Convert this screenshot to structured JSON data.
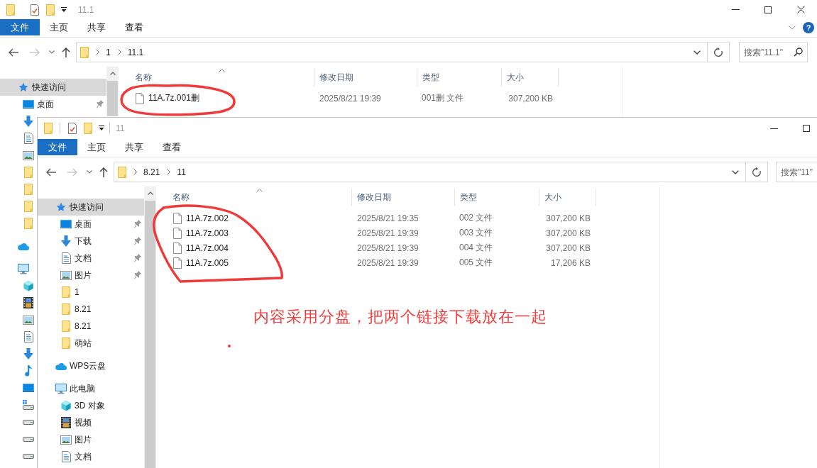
{
  "windows": [
    {
      "title": "11.1",
      "file_menu": "文件",
      "ribbon_tabs": [
        "主页",
        "共享",
        "查看"
      ],
      "help": "?",
      "nav": {
        "back_disabled": false,
        "forward_disabled": true
      },
      "address_path": [
        "1",
        "11.1"
      ],
      "search": {
        "placeholder": "搜索\"11.1\""
      },
      "sidebar": [
        {
          "kind": "quick_access",
          "label": "快速访问",
          "selected": true,
          "children": [
            {
              "kind": "desktop",
              "label": "桌面",
              "selected": false,
              "pinned": true
            },
            {
              "kind": "downloads",
              "selected": false
            },
            {
              "kind": "documents",
              "selected": false
            },
            {
              "kind": "pictures",
              "selected": false
            },
            {
              "kind": "folder",
              "selected": false
            },
            {
              "kind": "folder",
              "selected": false
            },
            {
              "kind": "folder",
              "selected": false
            },
            {
              "kind": "folder",
              "selected": false
            }
          ]
        },
        {
          "kind": "cloud",
          "selected": false
        },
        {
          "kind": "computer",
          "selected": false,
          "children": [
            {
              "kind": "objects3d",
              "selected": false
            },
            {
              "kind": "videos",
              "selected": false
            },
            {
              "kind": "pictures",
              "selected": false
            },
            {
              "kind": "documents",
              "selected": false
            },
            {
              "kind": "downloads",
              "selected": false
            },
            {
              "kind": "music",
              "selected": false
            },
            {
              "kind": "desktop",
              "selected": false
            },
            {
              "kind": "system_drive",
              "selected": false
            },
            {
              "kind": "drive",
              "selected": false
            },
            {
              "kind": "drive",
              "selected": false
            },
            {
              "kind": "drive",
              "selected": false
            }
          ]
        }
      ],
      "columns": [
        {
          "label": "名称",
          "sorted": true
        },
        {
          "label": "修改日期",
          "sorted": false
        },
        {
          "label": "类型",
          "sorted": false
        },
        {
          "label": "大小",
          "sorted": false
        }
      ],
      "files": [
        {
          "name": "11A.7z.001删",
          "modified": "2025/8/21 19:39",
          "type": "001删 文件",
          "size": "307,200 KB"
        }
      ]
    },
    {
      "title": "11",
      "file_menu": "文件",
      "ribbon_tabs": [
        "主页",
        "共享",
        "查看"
      ],
      "nav": {
        "back_disabled": false,
        "forward_disabled": true
      },
      "address_path": [
        "8.21",
        "11"
      ],
      "search": {
        "placeholder": "搜索\"11\""
      },
      "sidebar": [
        {
          "kind": "quick_access",
          "label": "快速访问",
          "selected": true,
          "children": [
            {
              "kind": "desktop",
              "label": "桌面",
              "selected": false,
              "pinned": true
            },
            {
              "kind": "downloads",
              "label": "下载",
              "selected": false,
              "pinned": true
            },
            {
              "kind": "documents",
              "label": "文档",
              "selected": false,
              "pinned": true
            },
            {
              "kind": "pictures",
              "label": "图片",
              "selected": false,
              "pinned": true
            },
            {
              "kind": "folder",
              "label": "1",
              "selected": false,
              "pinned": false
            },
            {
              "kind": "folder",
              "label": "8.21",
              "selected": false,
              "pinned": false
            },
            {
              "kind": "folder",
              "label": "8.21",
              "selected": false,
              "pinned": false
            },
            {
              "kind": "folder",
              "label": "萌站",
              "selected": false,
              "pinned": false
            }
          ]
        },
        {
          "kind": "cloud",
          "label": "WPS云盘",
          "selected": false
        },
        {
          "kind": "computer",
          "label": "此电脑",
          "selected": false,
          "children": [
            {
              "kind": "objects3d",
              "label": "3D 对象",
              "selected": false
            },
            {
              "kind": "videos",
              "label": "视频",
              "selected": false
            },
            {
              "kind": "pictures",
              "label": "图片",
              "selected": false
            },
            {
              "kind": "documents",
              "label": "文档",
              "selected": false
            }
          ]
        }
      ],
      "columns": [
        {
          "label": "名称",
          "sorted": true
        },
        {
          "label": "修改日期",
          "sorted": false
        },
        {
          "label": "类型",
          "sorted": false
        },
        {
          "label": "大小",
          "sorted": false
        }
      ],
      "files": [
        {
          "name": "11A.7z.002",
          "modified": "2025/8/21 19:35",
          "type": "002 文件",
          "size": "307,200 KB"
        },
        {
          "name": "11A.7z.003",
          "modified": "2025/8/21 19:39",
          "type": "003 文件",
          "size": "307,200 KB"
        },
        {
          "name": "11A.7z.004",
          "modified": "2025/8/21 19:39",
          "type": "004 文件",
          "size": "307,200 KB"
        },
        {
          "name": "11A.7z.005",
          "modified": "2025/8/21 19:39",
          "type": "005 文件",
          "size": "17,206 KB"
        }
      ]
    }
  ],
  "annotation": {
    "note": "内容采用分盘，把两个链接下载放在一起"
  }
}
